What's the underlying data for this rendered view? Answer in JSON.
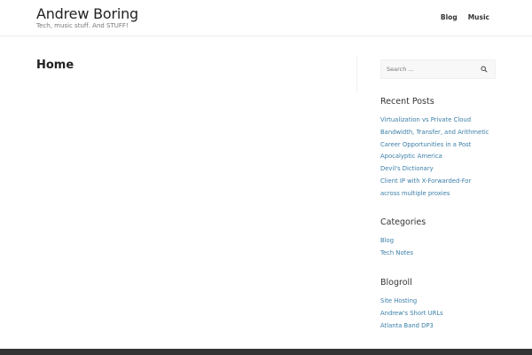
{
  "site": {
    "title": "Andrew Boring",
    "tagline": "Tech, music stuff. And STUFF!"
  },
  "nav": [
    "Blog",
    "Music"
  ],
  "main": {
    "title": "Home"
  },
  "search": {
    "placeholder": "Search ..."
  },
  "widgets": {
    "recent_posts": {
      "title": "Recent Posts",
      "items": [
        "Virtualization vs Private Cloud",
        "Bandwidth, Transfer, and Arithmetic",
        "Career Opportunities in a Post Apocalyptic America",
        "Devil's Dictionary",
        "Client IP with X-Forwarded-For across multiple proxies"
      ]
    },
    "categories": {
      "title": "Categories",
      "items": [
        "Blog",
        "Tech Notes"
      ]
    },
    "blogroll": {
      "title": "Blogroll",
      "items": [
        "Site Hosting",
        "Andrew's Short URLs",
        "Atlanta Band DP3"
      ]
    }
  }
}
